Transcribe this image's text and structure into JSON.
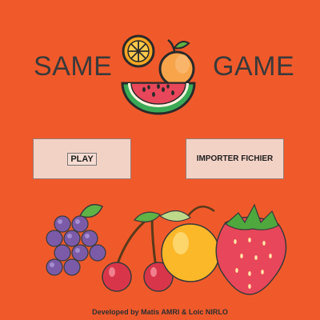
{
  "title": {
    "left_word": "SAME",
    "right_word": "GAME"
  },
  "buttons": {
    "play_label": "PLAY",
    "import_label": "IMPORTER FICHIER"
  },
  "footer": {
    "credits": "Developed by Matis AMRI & Loic NIRLO"
  },
  "colors": {
    "background": "#F05A2B",
    "button_fill": "#F3D2C6",
    "title_text": "#3A3A3A"
  },
  "icons": [
    "fruit-logo-icon",
    "orange-slice-icon",
    "watermelon-icon",
    "orange-icon",
    "grapes-icon",
    "cherries-icon",
    "strawberry-icon"
  ]
}
